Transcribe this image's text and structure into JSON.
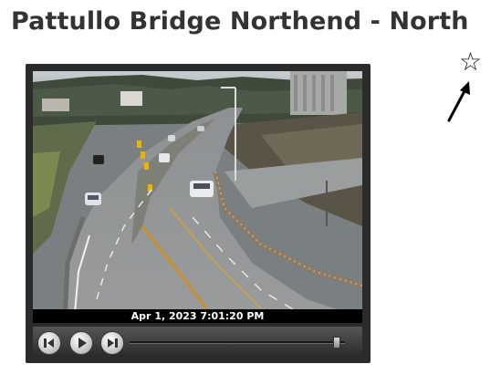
{
  "page": {
    "title": "Pattullo Bridge Northend - North"
  },
  "favorite": {
    "icon": "star-outline-icon",
    "glyph": "☆"
  },
  "annotation": {
    "icon": "arrow-pointer-icon"
  },
  "player": {
    "timestamp": "Apr 1, 2023 7:01:20 PM",
    "controls": [
      {
        "icon": "previous-frame-icon"
      },
      {
        "icon": "play-icon"
      },
      {
        "icon": "next-frame-icon"
      }
    ],
    "seek_position": 0.96
  },
  "colors": {
    "title": "#333333",
    "player_bg": "#2b2b2b",
    "timestamp_bar": "#000000"
  }
}
